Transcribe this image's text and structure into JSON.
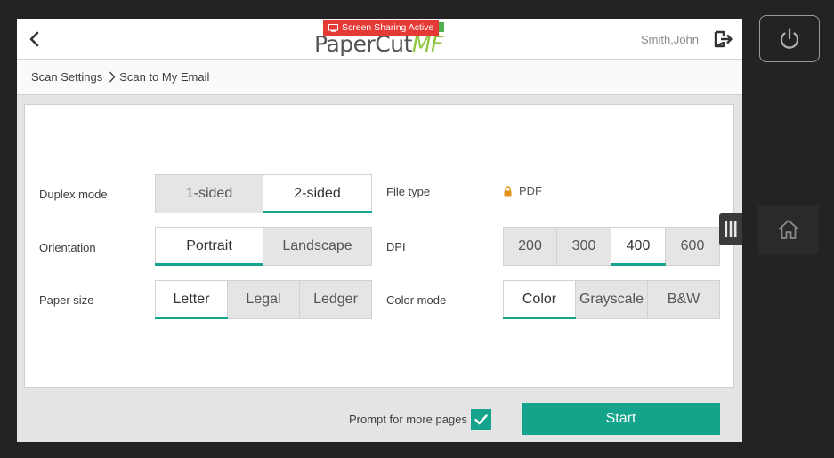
{
  "header": {
    "logo_primary": "PaperCut",
    "logo_suffix": "MF",
    "screen_sharing_badge": "Screen Sharing Active",
    "user_name": "Smith,John"
  },
  "breadcrumb": {
    "parent": "Scan Settings",
    "current": "Scan to My Email"
  },
  "settings": {
    "duplex": {
      "label": "Duplex mode",
      "options": [
        "1-sided",
        "2-sided"
      ],
      "selected": "2-sided"
    },
    "orientation": {
      "label": "Orientation",
      "options": [
        "Portrait",
        "Landscape"
      ],
      "selected": "Portrait"
    },
    "paper_size": {
      "label": "Paper size",
      "options": [
        "Letter",
        "Legal",
        "Ledger"
      ],
      "selected": "Letter"
    },
    "file_type": {
      "label": "File type",
      "value": "PDF",
      "locked": true
    },
    "dpi": {
      "label": "DPI",
      "options": [
        "200",
        "300",
        "400",
        "600"
      ],
      "selected": "400"
    },
    "color_mode": {
      "label": "Color mode",
      "options": [
        "Color",
        "Grayscale",
        "B&W"
      ],
      "selected": "Color"
    }
  },
  "footer": {
    "prompt_label": "Prompt for more pages",
    "prompt_checked": true,
    "start_label": "Start"
  },
  "colors": {
    "accent": "#14a38b",
    "brand_green": "#8dc63f",
    "badge_red": "#e53935"
  },
  "icons": [
    "back-chevron-icon",
    "logout-icon",
    "lock-icon",
    "checkmark-icon",
    "power-icon",
    "home-icon",
    "drag-handle-icon",
    "screen-share-icon"
  ]
}
